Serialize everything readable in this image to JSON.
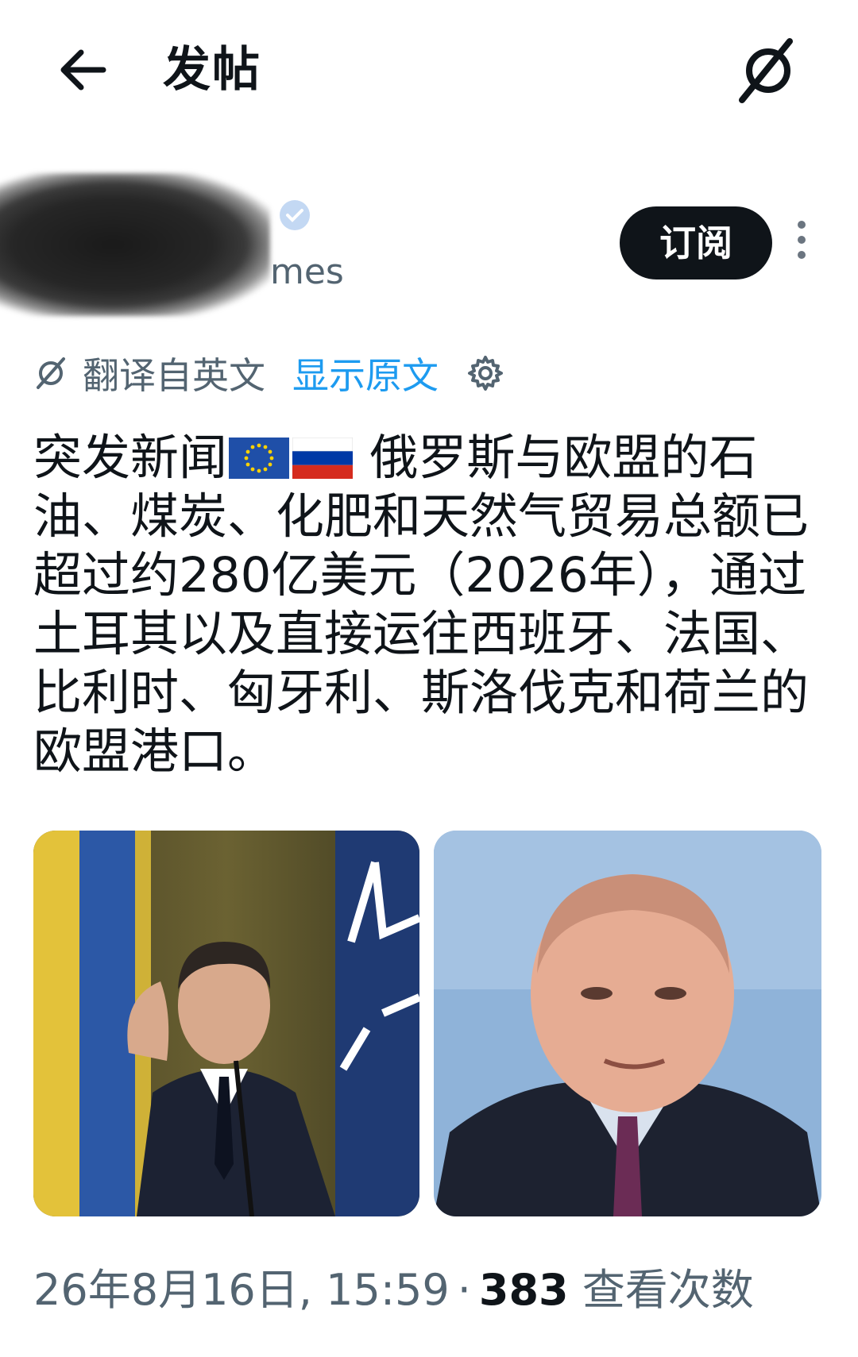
{
  "header": {
    "back_icon": "arrow-left-icon",
    "title": "发帖",
    "grok_icon": "grok-slash-icon"
  },
  "author": {
    "name": "",
    "handle": "mes",
    "verified_icon": "verified-badge-icon",
    "subscribe_label": "订阅",
    "more_icon": "more-vertical-icon"
  },
  "translation": {
    "icon": "grok-slash-icon",
    "label": "翻译自英文",
    "show_original": "显示原文",
    "settings_icon": "gear-icon"
  },
  "post": {
    "prefix": "突发新闻",
    "flags": [
      "eu-flag-icon",
      "russia-flag-icon"
    ],
    "text": "俄罗斯与欧盟的石油、煤炭、化肥和天然气贸易总额已超过约280亿美元（2026年），通过土耳其以及直接运往西班牙、法国、比利时、匈牙利、斯洛伐克和荷兰的欧盟港口。"
  },
  "media": {
    "image_left": "photo-speaker-with-flags",
    "image_right": "photo-smiling-man-portrait"
  },
  "meta": {
    "timestamp": "26年8月16日, 15:59",
    "separator": "·",
    "views_count": "383",
    "views_label": "查看次数"
  },
  "colors": {
    "text": "#0f1419",
    "secondary": "#536471",
    "link": "#1d9bf0",
    "button": "#0f1419"
  }
}
